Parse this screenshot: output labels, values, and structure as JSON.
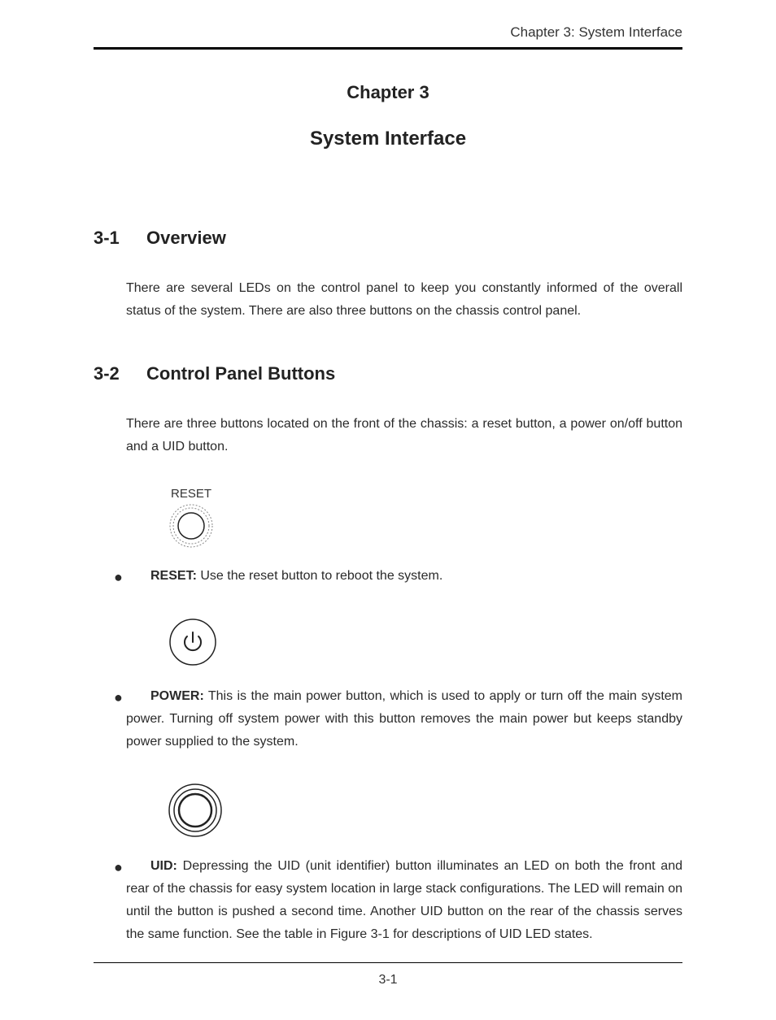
{
  "header": {
    "running_head": "Chapter 3: System Interface"
  },
  "chapter": {
    "label": "Chapter 3",
    "title": "System Interface"
  },
  "sections": {
    "overview": {
      "number": "3-1",
      "title": "Overview",
      "body": "There are several LEDs on the control panel to keep you constantly informed of the overall status of the system.  There are also three buttons on the chassis control panel."
    },
    "control_panel": {
      "number": "3-2",
      "title": "Control Panel Buttons",
      "body": "There are three buttons located on the front of the chassis: a reset button, a power on/off button and a UID button."
    }
  },
  "buttons": {
    "reset": {
      "figure_label": "RESET",
      "label": "RESET:",
      "desc": "  Use the reset button to reboot the system."
    },
    "power": {
      "label": "POWER:",
      "desc": "  This is the main power button, which is used to apply or turn off the main system power.  Turning off system power with this button removes the main power but keeps standby power supplied to the system."
    },
    "uid": {
      "label": "UID:",
      "desc": "  Depressing the UID (unit identifier) button illuminates an LED on both the front and rear of the chassis for easy system location in large stack configurations.  The LED will remain on until the button is pushed a second time.  Another UID button on the rear of the chassis serves the same function.  See the table in Figure 3-1 for descriptions of UID LED states."
    }
  },
  "footer": {
    "page_number": "3-1"
  }
}
